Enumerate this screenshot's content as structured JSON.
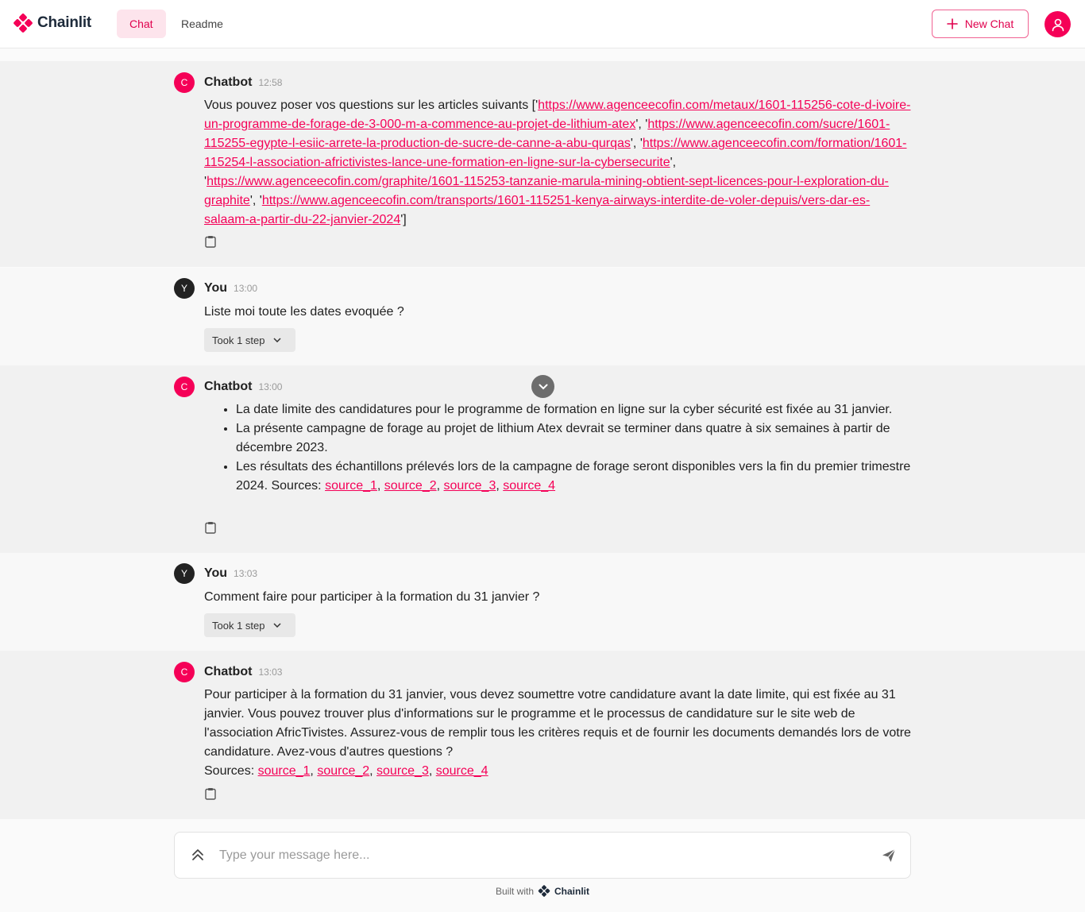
{
  "app": {
    "name": "Chainlit",
    "tabs": [
      {
        "label": "Chat"
      },
      {
        "label": "Readme"
      }
    ],
    "new_chat_label": "New Chat"
  },
  "messages": [
    {
      "author": "Chatbot",
      "time": "12:58",
      "intro": "Vous pouvez poser vos questions sur les articles suivants [",
      "links": [
        "https://www.agenceecofin.com/metaux/1601-115256-cote-d-ivoire-un-programme-de-forage-de-3-000-m-a-commence-au-projet-de-lithium-atex",
        "https://www.agenceecofin.com/sucre/1601-115255-egypte-l-esiic-arrete-la-production-de-sucre-de-canne-a-abu-qurqas",
        "https://www.agenceecofin.com/formation/1601-115254-l-association-africtivistes-lance-une-formation-en-ligne-sur-la-cybersecurite",
        "https://www.agenceecofin.com/graphite/1601-115253-tanzanie-marula-mining-obtient-sept-licences-pour-l-exploration-du-graphite",
        "https://www.agenceecofin.com/transports/1601-115251-kenya-airways-interdite-de-voler-depuis/vers-dar-es-salaam-a-partir-du-22-janvier-2024"
      ]
    },
    {
      "author": "You",
      "time": "13:00",
      "text": "Liste moi toute les dates evoquée ?",
      "step": "Took 1 step"
    },
    {
      "author": "Chatbot",
      "time": "13:00",
      "bullets": [
        "La date limite des candidatures pour le programme de formation en ligne sur la cyber sécurité est fixée au 31 janvier.",
        "La présente campagne de forage au projet de lithium Atex devrait se terminer dans quatre à six semaines à partir de décembre 2023.",
        "Les résultats des échantillons prélevés lors de la campagne de forage seront disponibles vers la fin du premier trimestre 2024. Sources: "
      ],
      "sources": [
        "source_1",
        "source_2",
        "source_3",
        "source_4"
      ]
    },
    {
      "author": "You",
      "time": "13:03",
      "text": "Comment faire pour participer à la formation du 31 janvier ?",
      "step": "Took 1 step"
    },
    {
      "author": "Chatbot",
      "time": "13:03",
      "text": "Pour participer à la formation du 31 janvier, vous devez soumettre votre candidature avant la date limite, qui est fixée au 31 janvier. Vous pouvez trouver plus d'informations sur le programme et le processus de candidature sur le site web de l'association AfricTivistes. Assurez-vous de remplir tous les critères requis et de fournir les documents demandés lors de votre candidature. Avez-vous d'autres questions ?",
      "sources_label": "Sources: ",
      "sources": [
        "source_1",
        "source_2",
        "source_3",
        "source_4"
      ]
    }
  ],
  "composer": {
    "placeholder": "Type your message here..."
  },
  "footer": {
    "built_with": "Built with",
    "brand": "Chainlit"
  },
  "colors": {
    "accent": "#f50057",
    "bot_bg": "#f1f1f1",
    "user_bg": "#f8f8f8"
  },
  "icons": [
    "chainlit-logo-icon",
    "plus-icon",
    "user-icon",
    "clipboard-icon",
    "chevron-down-icon",
    "expand-up-icon",
    "send-icon"
  ]
}
